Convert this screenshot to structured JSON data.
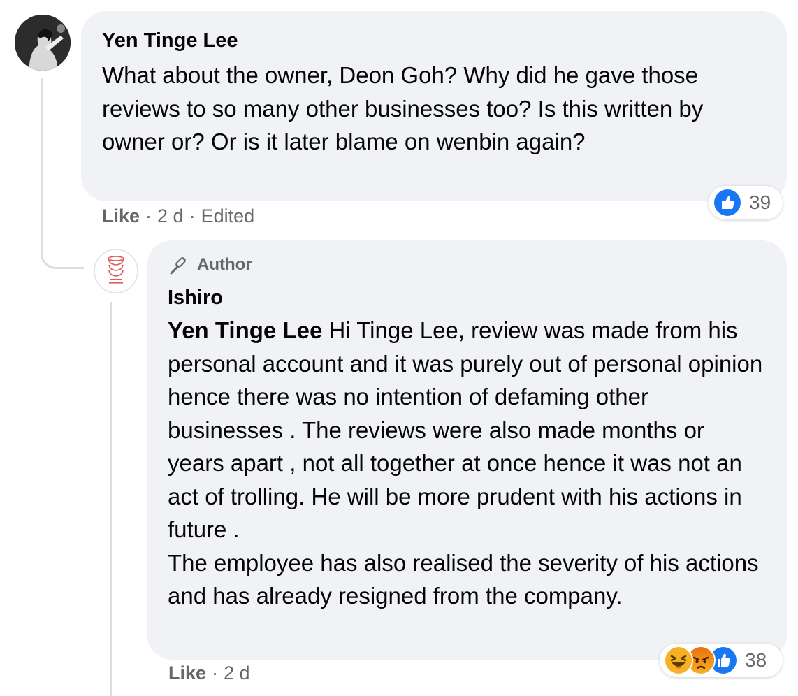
{
  "comment": {
    "author": "Yen Tinge Lee",
    "text": "What about the owner, Deon Goh? Why did he gave those reviews to so many other businesses too? Is this written by owner or? Or is it later blame on wenbin again?",
    "like_label": "Like",
    "time": "2 d",
    "edited": "Edited",
    "reaction_count": "39",
    "reactions": [
      "like-icon"
    ]
  },
  "reply": {
    "badge": "Author",
    "author": "Ishiro",
    "mention": "Yen Tinge Lee",
    "text_line1": "Hi Tinge Lee, review was made from his personal account and it was purely out of personal opinion hence there was no intention of defaming other businesses . The reviews were also made months or years apart , not all together at once hence it was not an act of trolling. He will be more prudent with his actions in future .",
    "text_line2": "The employee has also realised the severity of his actions and has already resigned from the company.",
    "like_label": "Like",
    "time": "2 d",
    "reaction_count": "38",
    "reactions": [
      "haha-icon",
      "angry-icon",
      "like-icon"
    ]
  },
  "colors": {
    "bubble": "#f0f2f5",
    "meta_text": "#65676b",
    "like_blue": "#1877f2",
    "haha_yellow": "#f7b125",
    "angry_orange": "#e9710f"
  }
}
